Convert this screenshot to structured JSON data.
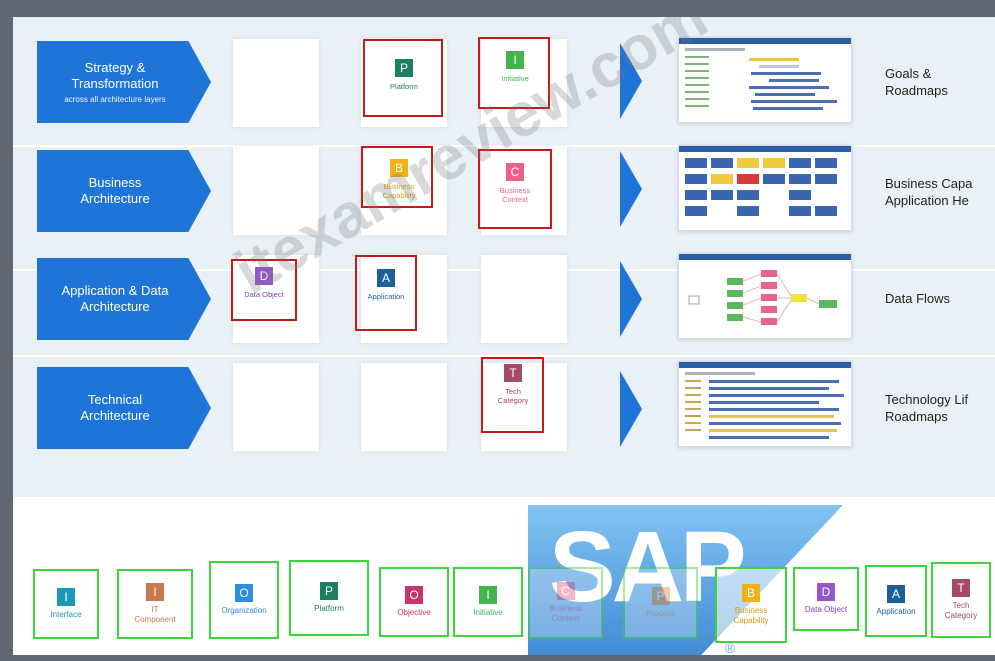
{
  "layers": [
    {
      "label": "Strategy &\nTransformation",
      "sub": "across all architecture layers"
    },
    {
      "label": "Business\nArchitecture",
      "sub": ""
    },
    {
      "label": "Application & Data\nArchitecture",
      "sub": ""
    },
    {
      "label": "Technical\nArchitecture",
      "sub": ""
    }
  ],
  "grid_tiles": [
    {
      "letter": "P",
      "label": "Platform",
      "color": "#1b7f63",
      "text_color": "#1b7f63"
    },
    {
      "letter": "I",
      "label": "Initiative",
      "color": "#43b54e",
      "text_color": "#43b54e"
    },
    {
      "letter": "B",
      "label": "Business\nCapability",
      "color": "#f2b11b",
      "text_color": "#d79d12"
    },
    {
      "letter": "C",
      "label": "Business\nContext",
      "color": "#ee5f88",
      "text_color": "#ee5f88"
    },
    {
      "letter": "D",
      "label": "Data Object",
      "color": "#9357c8",
      "text_color": "#7d45b5"
    },
    {
      "letter": "A",
      "label": "Application",
      "color": "#1c5f9a",
      "text_color": "#1c5f9a"
    },
    {
      "letter": "T",
      "label": "Tech\nCategory",
      "color": "#a44a67",
      "text_color": "#a44a67"
    }
  ],
  "outcomes": [
    "Goals &\nRoadmaps",
    "Business Capa\nApplication He",
    "Data Flows",
    "Technology Lif\nRoadmaps"
  ],
  "bottom_tiles": [
    {
      "letter": "I",
      "label": "Interface",
      "color": "#1d97b5",
      "text_color": "#1d97b5"
    },
    {
      "letter": "I",
      "label": "IT\nComponent",
      "color": "#c97a4d",
      "text_color": "#c97a4d"
    },
    {
      "letter": "O",
      "label": "Organization",
      "color": "#2d8de0",
      "text_color": "#2d8de0"
    },
    {
      "letter": "P",
      "label": "Platform",
      "color": "#1b7f63",
      "text_color": "#1b7f63"
    },
    {
      "letter": "O",
      "label": "Objective",
      "color": "#c7356c",
      "text_color": "#c7356c"
    },
    {
      "letter": "I",
      "label": "Initiative",
      "color": "#43b54e",
      "text_color": "#43b54e"
    },
    {
      "letter": "C",
      "label": "Business\nContext",
      "color": "#ee5f88",
      "text_color": "#ee5f88"
    },
    {
      "letter": "P",
      "label": "Process",
      "color": "#e98a3a",
      "text_color": "#e98a3a"
    },
    {
      "letter": "B",
      "label": "Business\nCapability",
      "color": "#f2b11b",
      "text_color": "#d79d12"
    },
    {
      "letter": "D",
      "label": "Data Object",
      "color": "#9357c8",
      "text_color": "#7d45b5"
    },
    {
      "letter": "A",
      "label": "Application",
      "color": "#1c5f9a",
      "text_color": "#1c5f9a"
    },
    {
      "letter": "T",
      "label": "Tech\nCategory",
      "color": "#a44a67",
      "text_color": "#a44a67"
    }
  ],
  "watermark": "itexamreview.com",
  "logo": {
    "text": "SAP",
    "reg": "®"
  }
}
